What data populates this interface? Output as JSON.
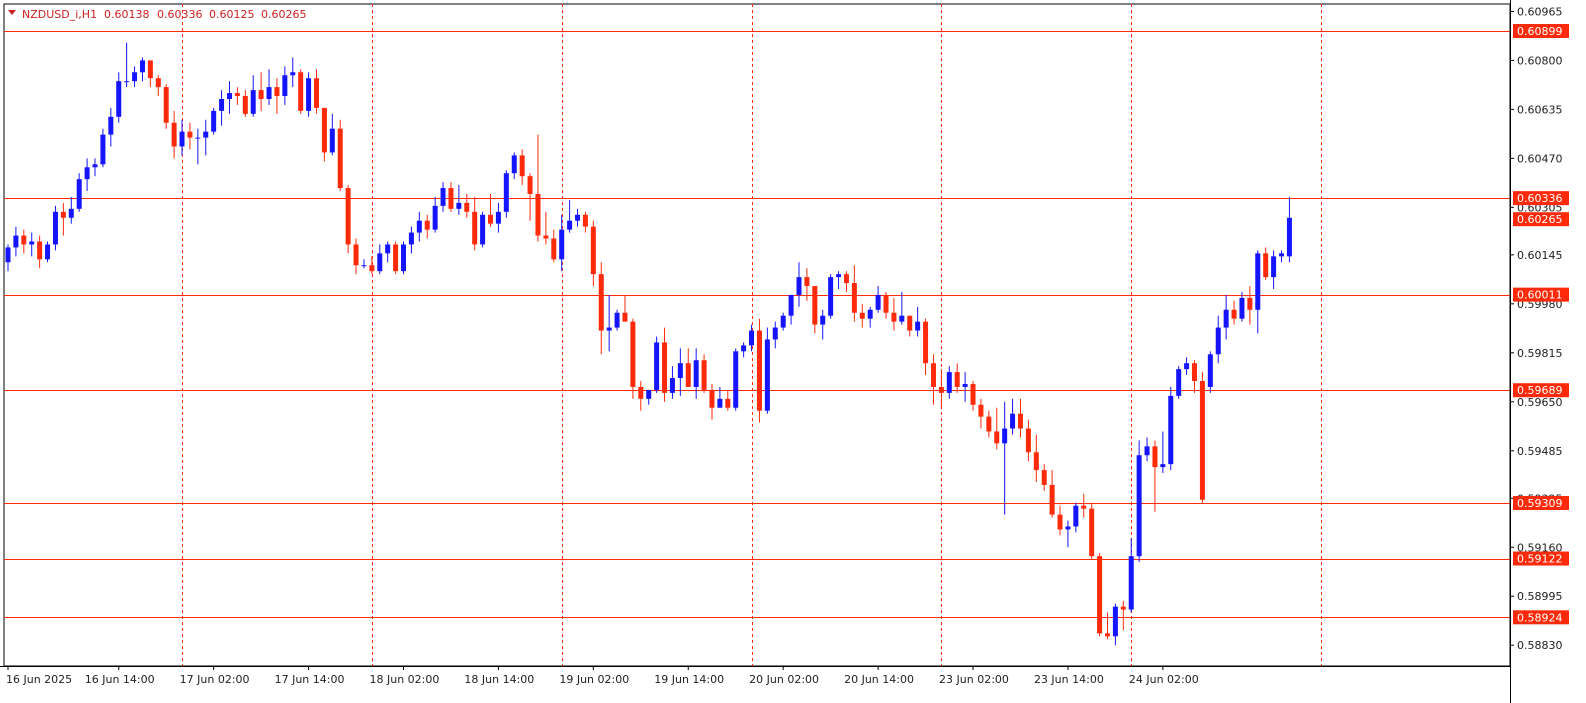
{
  "header": {
    "symbol": "NZDUSD_i,H1",
    "open": "0.60138",
    "high": "0.60336",
    "low": "0.60125",
    "close": "0.60265"
  },
  "chart_data": {
    "type": "candlestick",
    "colors": {
      "up": "#1414ff",
      "down": "#ff2a0a",
      "level_line": "#ff2a0a",
      "grid": "#ff2a0a"
    },
    "ylim": [
      0.5876,
      0.6099
    ],
    "y_ticks": [
      "0.60965",
      "0.60800",
      "0.60635",
      "0.60470",
      "0.60305",
      "0.60145",
      "0.59980",
      "0.59815",
      "0.59650",
      "0.59485",
      "0.59325",
      "0.59160",
      "0.58995",
      "0.58830"
    ],
    "price_labels": [
      "0.60899",
      "0.60336",
      "0.60265",
      "0.60011",
      "0.59689",
      "0.59309",
      "0.59122",
      "0.58924"
    ],
    "level_lines": [
      0.60899,
      0.60336,
      0.60011,
      0.59689,
      0.59309,
      0.59122,
      0.58924
    ],
    "current_price": 0.60265,
    "x_labels": [
      {
        "text": "16 Jun 2025",
        "i": 0
      },
      {
        "text": "16 Jun 14:00",
        "i": 14
      },
      {
        "text": "17 Jun 02:00",
        "i": 26
      },
      {
        "text": "17 Jun 14:00",
        "i": 38
      },
      {
        "text": "18 Jun 02:00",
        "i": 50
      },
      {
        "text": "18 Jun 14:00",
        "i": 62
      },
      {
        "text": "19 Jun 02:00",
        "i": 74
      },
      {
        "text": "19 Jun 14:00",
        "i": 86
      },
      {
        "text": "20 Jun 02:00",
        "i": 98
      },
      {
        "text": "20 Jun 14:00",
        "i": 110
      },
      {
        "text": "23 Jun 02:00",
        "i": 122
      },
      {
        "text": "23 Jun 14:00",
        "i": 134
      },
      {
        "text": "24 Jun 02:00",
        "i": 146
      }
    ],
    "grid_candles": [
      22,
      46,
      70,
      94,
      118,
      142,
      166
    ],
    "candles": [
      [
        0.6012,
        0.6018,
        0.6009,
        0.6017
      ],
      [
        0.6017,
        0.6024,
        0.6014,
        0.6021
      ],
      [
        0.6021,
        0.6023,
        0.6015,
        0.6018
      ],
      [
        0.6018,
        0.6022,
        0.6014,
        0.6019
      ],
      [
        0.6019,
        0.6021,
        0.601,
        0.6013
      ],
      [
        0.6013,
        0.6019,
        0.6012,
        0.6018
      ],
      [
        0.6018,
        0.6031,
        0.6016,
        0.6029
      ],
      [
        0.6029,
        0.6032,
        0.6021,
        0.6027
      ],
      [
        0.6027,
        0.6034,
        0.6025,
        0.603
      ],
      [
        0.603,
        0.6042,
        0.6029,
        0.604
      ],
      [
        0.604,
        0.6047,
        0.6036,
        0.6044
      ],
      [
        0.6044,
        0.6047,
        0.6041,
        0.6045
      ],
      [
        0.6045,
        0.6057,
        0.6044,
        0.6055
      ],
      [
        0.6055,
        0.6064,
        0.6051,
        0.6061
      ],
      [
        0.6061,
        0.6076,
        0.6059,
        0.6073
      ],
      [
        0.6073,
        0.6086,
        0.6071,
        0.6073
      ],
      [
        0.6073,
        0.6078,
        0.6071,
        0.6076
      ],
      [
        0.6076,
        0.6081,
        0.6073,
        0.608
      ],
      [
        0.608,
        0.608,
        0.6071,
        0.6074
      ],
      [
        0.6074,
        0.6075,
        0.6068,
        0.6071
      ],
      [
        0.6071,
        0.6072,
        0.6057,
        0.6059
      ],
      [
        0.6059,
        0.6063,
        0.6047,
        0.6051
      ],
      [
        0.6051,
        0.606,
        0.6048,
        0.6056
      ],
      [
        0.6056,
        0.6059,
        0.605,
        0.6054
      ],
      [
        0.6054,
        0.6057,
        0.6045,
        0.6054
      ],
      [
        0.6054,
        0.606,
        0.6048,
        0.6056
      ],
      [
        0.6056,
        0.6064,
        0.6055,
        0.6063
      ],
      [
        0.6063,
        0.607,
        0.6058,
        0.6067
      ],
      [
        0.6067,
        0.6073,
        0.6062,
        0.6069
      ],
      [
        0.6069,
        0.6071,
        0.6065,
        0.6068
      ],
      [
        0.6068,
        0.607,
        0.6061,
        0.6062
      ],
      [
        0.6062,
        0.6075,
        0.6061,
        0.607
      ],
      [
        0.607,
        0.6076,
        0.6063,
        0.6067
      ],
      [
        0.6067,
        0.6077,
        0.6065,
        0.6071
      ],
      [
        0.6071,
        0.6074,
        0.6062,
        0.6068
      ],
      [
        0.6068,
        0.6078,
        0.6065,
        0.6075
      ],
      [
        0.6075,
        0.6081,
        0.6071,
        0.6076
      ],
      [
        0.6076,
        0.6077,
        0.6062,
        0.6063
      ],
      [
        0.6063,
        0.6076,
        0.6061,
        0.6074
      ],
      [
        0.6074,
        0.6077,
        0.6062,
        0.6064
      ],
      [
        0.6064,
        0.6064,
        0.6046,
        0.6049
      ],
      [
        0.6049,
        0.6062,
        0.6048,
        0.6057
      ],
      [
        0.6057,
        0.606,
        0.6036,
        0.6037
      ],
      [
        0.6037,
        0.6038,
        0.6015,
        0.6018
      ],
      [
        0.6018,
        0.602,
        0.6008,
        0.6011
      ],
      [
        0.6011,
        0.6013,
        0.601,
        0.6011
      ],
      [
        0.6011,
        0.6014,
        0.6008,
        0.6009
      ],
      [
        0.6009,
        0.6018,
        0.6008,
        0.6015
      ],
      [
        0.6015,
        0.6019,
        0.6012,
        0.6018
      ],
      [
        0.6018,
        0.6019,
        0.6008,
        0.6009
      ],
      [
        0.6009,
        0.6019,
        0.6008,
        0.6018
      ],
      [
        0.6018,
        0.6024,
        0.6015,
        0.6022
      ],
      [
        0.6022,
        0.6029,
        0.6019,
        0.6026
      ],
      [
        0.6026,
        0.6028,
        0.602,
        0.6023
      ],
      [
        0.6023,
        0.6034,
        0.6022,
        0.6031
      ],
      [
        0.6031,
        0.6039,
        0.6029,
        0.6037
      ],
      [
        0.6037,
        0.6039,
        0.6029,
        0.603
      ],
      [
        0.603,
        0.6038,
        0.6028,
        0.6032
      ],
      [
        0.6032,
        0.6035,
        0.6027,
        0.6029
      ],
      [
        0.6029,
        0.6034,
        0.6016,
        0.6018
      ],
      [
        0.6018,
        0.6029,
        0.6017,
        0.6028
      ],
      [
        0.6028,
        0.6035,
        0.6024,
        0.6025
      ],
      [
        0.6025,
        0.6032,
        0.6022,
        0.6029
      ],
      [
        0.6029,
        0.6043,
        0.6027,
        0.6042
      ],
      [
        0.6042,
        0.6049,
        0.604,
        0.6048
      ],
      [
        0.6048,
        0.605,
        0.6038,
        0.6041
      ],
      [
        0.6041,
        0.6042,
        0.6026,
        0.6035
      ],
      [
        0.6035,
        0.6055,
        0.6019,
        0.6021
      ],
      [
        0.6021,
        0.6029,
        0.6018,
        0.602
      ],
      [
        0.602,
        0.6023,
        0.6012,
        0.6013
      ],
      [
        0.6013,
        0.6028,
        0.6009,
        0.6023
      ],
      [
        0.6023,
        0.6033,
        0.6022,
        0.6026
      ],
      [
        0.6026,
        0.603,
        0.6024,
        0.6028
      ],
      [
        0.6028,
        0.6029,
        0.6022,
        0.6024
      ],
      [
        0.6024,
        0.6026,
        0.6004,
        0.6008
      ],
      [
        0.6008,
        0.6012,
        0.5981,
        0.5989
      ],
      [
        0.5989,
        0.6001,
        0.5982,
        0.599
      ],
      [
        0.599,
        0.5996,
        0.5989,
        0.5995
      ],
      [
        0.5995,
        0.6001,
        0.5993,
        0.5992
      ],
      [
        0.5992,
        0.5993,
        0.5966,
        0.597
      ],
      [
        0.597,
        0.5972,
        0.5962,
        0.5966
      ],
      [
        0.5966,
        0.5969,
        0.5964,
        0.5969
      ],
      [
        0.5969,
        0.5987,
        0.5968,
        0.5985
      ],
      [
        0.5985,
        0.599,
        0.5965,
        0.5968
      ],
      [
        0.5968,
        0.5977,
        0.5966,
        0.5973
      ],
      [
        0.5973,
        0.5983,
        0.5967,
        0.5978
      ],
      [
        0.5978,
        0.5983,
        0.597,
        0.597
      ],
      [
        0.597,
        0.5983,
        0.5966,
        0.5979
      ],
      [
        0.5979,
        0.5981,
        0.5968,
        0.5969
      ],
      [
        0.5969,
        0.5971,
        0.5959,
        0.5963
      ],
      [
        0.5963,
        0.597,
        0.5963,
        0.5966
      ],
      [
        0.5966,
        0.5969,
        0.5962,
        0.5963
      ],
      [
        0.5963,
        0.5983,
        0.5962,
        0.5982
      ],
      [
        0.5982,
        0.5985,
        0.598,
        0.5984
      ],
      [
        0.5984,
        0.5991,
        0.5982,
        0.5989
      ],
      [
        0.5989,
        0.5993,
        0.5958,
        0.5962
      ],
      [
        0.5962,
        0.599,
        0.5961,
        0.5986
      ],
      [
        0.5986,
        0.5992,
        0.5983,
        0.599
      ],
      [
        0.599,
        0.5995,
        0.5989,
        0.5994
      ],
      [
        0.5994,
        0.6001,
        0.5991,
        0.6001
      ],
      [
        0.6001,
        0.6012,
        0.5997,
        0.6007
      ],
      [
        0.6007,
        0.601,
        0.5999,
        0.6004
      ],
      [
        0.6004,
        0.6004,
        0.5988,
        0.5991
      ],
      [
        0.5991,
        0.5996,
        0.5986,
        0.5994
      ],
      [
        0.5994,
        0.6008,
        0.5993,
        0.6007
      ],
      [
        0.6007,
        0.6009,
        0.6003,
        0.6008
      ],
      [
        0.6008,
        0.6009,
        0.6002,
        0.6005
      ],
      [
        0.6005,
        0.6011,
        0.5992,
        0.5995
      ],
      [
        0.5995,
        0.5998,
        0.599,
        0.5993
      ],
      [
        0.5993,
        0.5997,
        0.599,
        0.5996
      ],
      [
        0.5996,
        0.6004,
        0.5995,
        0.6001
      ],
      [
        0.6001,
        0.6002,
        0.5993,
        0.5995
      ],
      [
        0.5995,
        0.6,
        0.5989,
        0.5992
      ],
      [
        0.5992,
        0.6002,
        0.5991,
        0.5994
      ],
      [
        0.5994,
        0.5994,
        0.5987,
        0.5989
      ],
      [
        0.5989,
        0.5997,
        0.5987,
        0.5992
      ],
      [
        0.5992,
        0.5993,
        0.5974,
        0.5978
      ],
      [
        0.5978,
        0.5981,
        0.5964,
        0.597
      ],
      [
        0.597,
        0.5976,
        0.5963,
        0.5968
      ],
      [
        0.5968,
        0.5977,
        0.5966,
        0.5975
      ],
      [
        0.5975,
        0.5978,
        0.5968,
        0.597
      ],
      [
        0.597,
        0.5975,
        0.5965,
        0.5971
      ],
      [
        0.5971,
        0.5972,
        0.5962,
        0.5964
      ],
      [
        0.5964,
        0.5966,
        0.5956,
        0.596
      ],
      [
        0.596,
        0.5962,
        0.5953,
        0.5955
      ],
      [
        0.5955,
        0.5963,
        0.5949,
        0.5951
      ],
      [
        0.5951,
        0.5965,
        0.5927,
        0.5956
      ],
      [
        0.5956,
        0.5966,
        0.5954,
        0.5961
      ],
      [
        0.5961,
        0.5966,
        0.5953,
        0.5956
      ],
      [
        0.5956,
        0.5959,
        0.5945,
        0.5948
      ],
      [
        0.5948,
        0.5954,
        0.5938,
        0.5942
      ],
      [
        0.5942,
        0.5944,
        0.5935,
        0.5937
      ],
      [
        0.5937,
        0.5942,
        0.5926,
        0.5927
      ],
      [
        0.5927,
        0.593,
        0.592,
        0.5922
      ],
      [
        0.5922,
        0.5925,
        0.5916,
        0.5923
      ],
      [
        0.5923,
        0.5931,
        0.5921,
        0.593
      ],
      [
        0.593,
        0.5934,
        0.5926,
        0.5929
      ],
      [
        0.5929,
        0.5931,
        0.5912,
        0.5913
      ],
      [
        0.5913,
        0.5914,
        0.5886,
        0.5887
      ],
      [
        0.5887,
        0.5894,
        0.5885,
        0.5886
      ],
      [
        0.5886,
        0.5897,
        0.5883,
        0.5896
      ],
      [
        0.5896,
        0.5898,
        0.5888,
        0.5895
      ],
      [
        0.5895,
        0.5919,
        0.5894,
        0.5913
      ],
      [
        0.5913,
        0.5952,
        0.5911,
        0.5947
      ],
      [
        0.5947,
        0.5953,
        0.5945,
        0.595
      ],
      [
        0.595,
        0.5952,
        0.5928,
        0.5943
      ],
      [
        0.5943,
        0.5955,
        0.5941,
        0.5944
      ],
      [
        0.5944,
        0.597,
        0.5942,
        0.5967
      ],
      [
        0.5967,
        0.5977,
        0.5966,
        0.5976
      ],
      [
        0.5976,
        0.598,
        0.5974,
        0.5978
      ],
      [
        0.5978,
        0.5979,
        0.5968,
        0.5972
      ],
      [
        0.5972,
        0.5975,
        0.5931,
        0.5932
      ],
      [
        0.597,
        0.5982,
        0.5968,
        0.5981
      ],
      [
        0.5981,
        0.5994,
        0.5978,
        0.599
      ],
      [
        0.599,
        0.6001,
        0.5986,
        0.5996
      ],
      [
        0.5996,
        0.5999,
        0.5991,
        0.5993
      ],
      [
        0.5993,
        0.6002,
        0.5992,
        0.6
      ],
      [
        0.6,
        0.6004,
        0.5991,
        0.5996
      ],
      [
        0.5996,
        0.6016,
        0.5988,
        0.6015
      ],
      [
        0.6015,
        0.6017,
        0.6006,
        0.6007
      ],
      [
        0.6007,
        0.6016,
        0.6003,
        0.6014
      ],
      [
        0.6014,
        0.6016,
        0.6012,
        0.6015
      ],
      [
        0.6014,
        0.6034,
        0.6012,
        0.6027
      ]
    ]
  }
}
